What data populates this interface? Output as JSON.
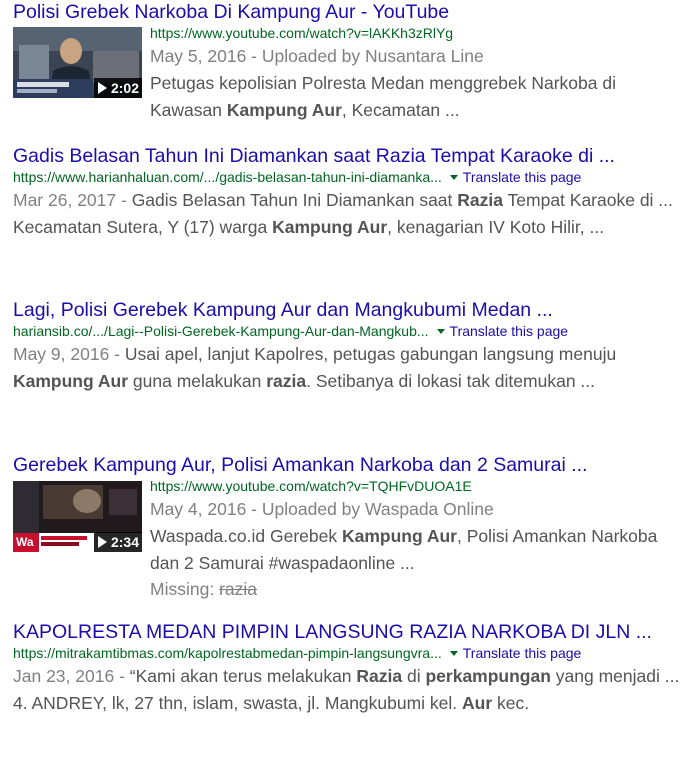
{
  "results": [
    {
      "title": "Polisi Grebek Narkoba Di Kampung Aur - YouTube",
      "url": "https://www.youtube.com/watch?v=lAKKh3zRlYg",
      "video": {
        "duration": "2:02",
        "date": "May 5, 2016",
        "uploaded_by": "Uploaded by Nusantara Line",
        "snippet_parts": [
          "Petugas kepolisian Polresta Medan menggrebek Narkoba di Kawasan ",
          "Kampung Aur",
          ", Kecamatan ..."
        ]
      }
    },
    {
      "title": "Gadis Belasan Tahun Ini Diamankan saat Razia Tempat Karaoke di ...",
      "url": "https://www.harianhaluan.com/.../gadis-belasan-tahun-ini-diamanka...",
      "translate": "Translate this page",
      "date": "Mar 26, 2017",
      "snippet_parts": [
        "Gadis Belasan Tahun Ini Diamankan saat ",
        "Razia",
        " Tempat Karaoke di ... Kecamatan Sutera, Y (17) warga ",
        "Kampung Aur",
        ", kenagarian IV Koto Hilir, ..."
      ]
    },
    {
      "title": "Lagi, Polisi Gerebek Kampung Aur dan Mangkubumi Medan ...",
      "url": "hariansib.co/.../Lagi--Polisi-Gerebek-Kampung-Aur-dan-Mangkub...",
      "translate": "Translate this page",
      "date": "May 9, 2016",
      "snippet_parts": [
        "Usai apel, lanjut Kapolres, petugas gabungan langsung menuju ",
        "Kampung Aur",
        " guna melakukan ",
        "razia",
        ". Setibanya di lokasi tak ditemukan ..."
      ]
    },
    {
      "title": "Gerebek Kampung Aur, Polisi Amankan Narkoba dan 2 Samurai ...",
      "url": "https://www.youtube.com/watch?v=TQHFvDUOA1E",
      "video": {
        "duration": "2:34",
        "date": "May 4, 2016",
        "uploaded_by": "Uploaded by Waspada Online",
        "snippet_parts": [
          "Waspada.co.id Gerebek ",
          "Kampung Aur",
          ", Polisi Amankan Narkoba dan 2 Samurai #waspadaonline ..."
        ],
        "missing_label": "Missing:",
        "missing_term": "razia",
        "logo_text": "Wa"
      }
    },
    {
      "title": "KAPOLRESTA MEDAN PIMPIN LANGSUNG RAZIA NARKOBA DI JLN ...",
      "url": "https://mitrakamtibmas.com/kapolrestabmedan-pimpin-langsungvra...",
      "translate": "Translate this page",
      "date": "Jan 23, 2016",
      "snippet_parts": [
        "“Kami akan terus melakukan ",
        "Razia",
        " di ",
        "perkampungan",
        " yang menjadi ... 4. ANDREY, lk, 27 thn, islam, swasta, jl. Mangkubumi kel. ",
        "Aur",
        " kec."
      ]
    }
  ],
  "separator": " - ",
  "colors": {
    "title_link": "#1a0dab",
    "url": "#006621",
    "snippet": "#545454",
    "date": "#808080"
  }
}
